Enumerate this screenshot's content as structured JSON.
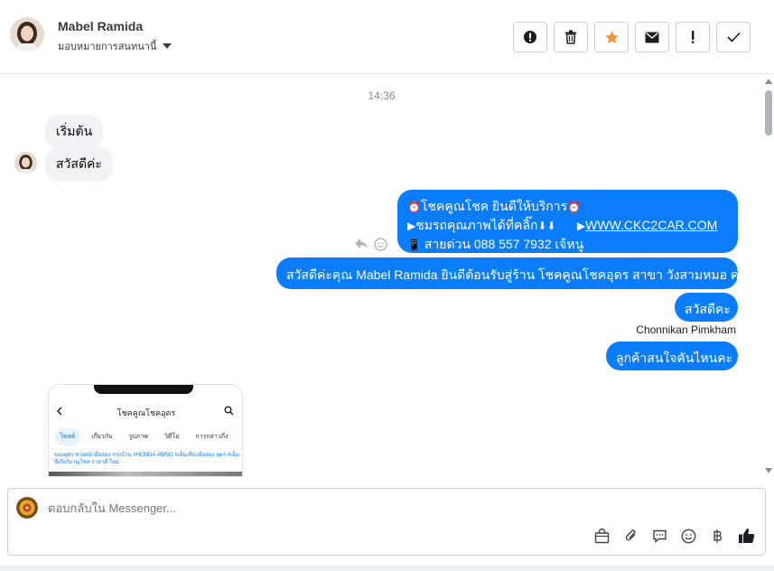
{
  "header": {
    "customer_name": "Mabel Ramida",
    "assign_label": "มอบหมายการสนทนานี้",
    "actions": [
      "report-icon",
      "trash-icon",
      "star-icon",
      "mail-icon",
      "exclamation-icon",
      "check-icon"
    ]
  },
  "thread": {
    "timestamp": "14:36",
    "incoming": [
      {
        "text": "เริ่มต้น"
      },
      {
        "text": "สวัสดีค่ะ"
      }
    ],
    "card": {
      "line1": "โชคคูณโชค ยินดีให้บริการ",
      "line2": "ชมรถคุณภาพได้ที่คลิ๊ก",
      "link": "WWW.CKC2CAR.COM",
      "line3": "สายด่วน 088 557 7932 เจ้หนู"
    },
    "welcome": "สวัสดีค่ะคุณ Mabel Ramida ยินดีต้อนรับสู่ร้าน โชคคูณโชคอุดร สาขา วังสามหมอ ค่ะ",
    "greeting": "สวัสดีคะ",
    "sender_name": "Chonnikan Pimkham",
    "question": "ลูกค้าสนใจคันไหนคะ",
    "screenshot": {
      "title": "โชคคูณโชคอุดร",
      "tabs": [
        "โพสต์",
        "เกี่ยวกับ",
        "รูปภาพ",
        "วิดีโอ",
        "การกล่าวถึง"
      ],
      "caption": "ของอุดร ช่างหน้ามือสอง #รถบ้าน #HONDA #BRIO #เต็มเทียบมือสอง อุดร #เต็มที่เกียร์ธาญโชค ราคาดี ใหม่"
    }
  },
  "composer": {
    "placeholder": "ตอบกลับใน Messenger...",
    "tools": [
      "bag-icon",
      "paperclip-icon",
      "chat-icon",
      "smiley-icon",
      "baht-icon",
      "thumbs-up-icon"
    ]
  },
  "colors": {
    "outgoing_bubble": "#0a7cff",
    "incoming_bubble": "#f0f2f5",
    "star": "#f7923b"
  }
}
